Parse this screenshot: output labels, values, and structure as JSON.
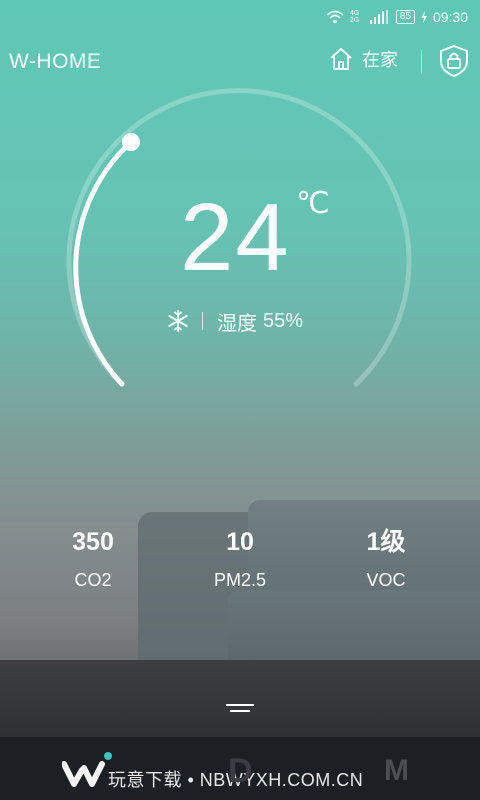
{
  "status_bar": {
    "network": "4G 2G",
    "battery": "85",
    "time": "09:30"
  },
  "header": {
    "app_title": "W-HOME",
    "home_label": "在家"
  },
  "climate": {
    "temperature": "24",
    "unit": "℃",
    "mode_icon": "snowflake-icon",
    "humidity_label": "湿度",
    "humidity_value": "55%"
  },
  "metrics": [
    {
      "value": "350",
      "label": "CO2"
    },
    {
      "value": "10",
      "label": "PM2.5"
    },
    {
      "value": "1级",
      "label": "VOC"
    }
  ],
  "watermark": {
    "text": "玩意下载 • NBWYXH.COM.CN",
    "letter_d": "D",
    "letter_m": "M"
  },
  "colors": {
    "accent": "#5fc7b6",
    "bottom_bar": "#1c1f24"
  }
}
